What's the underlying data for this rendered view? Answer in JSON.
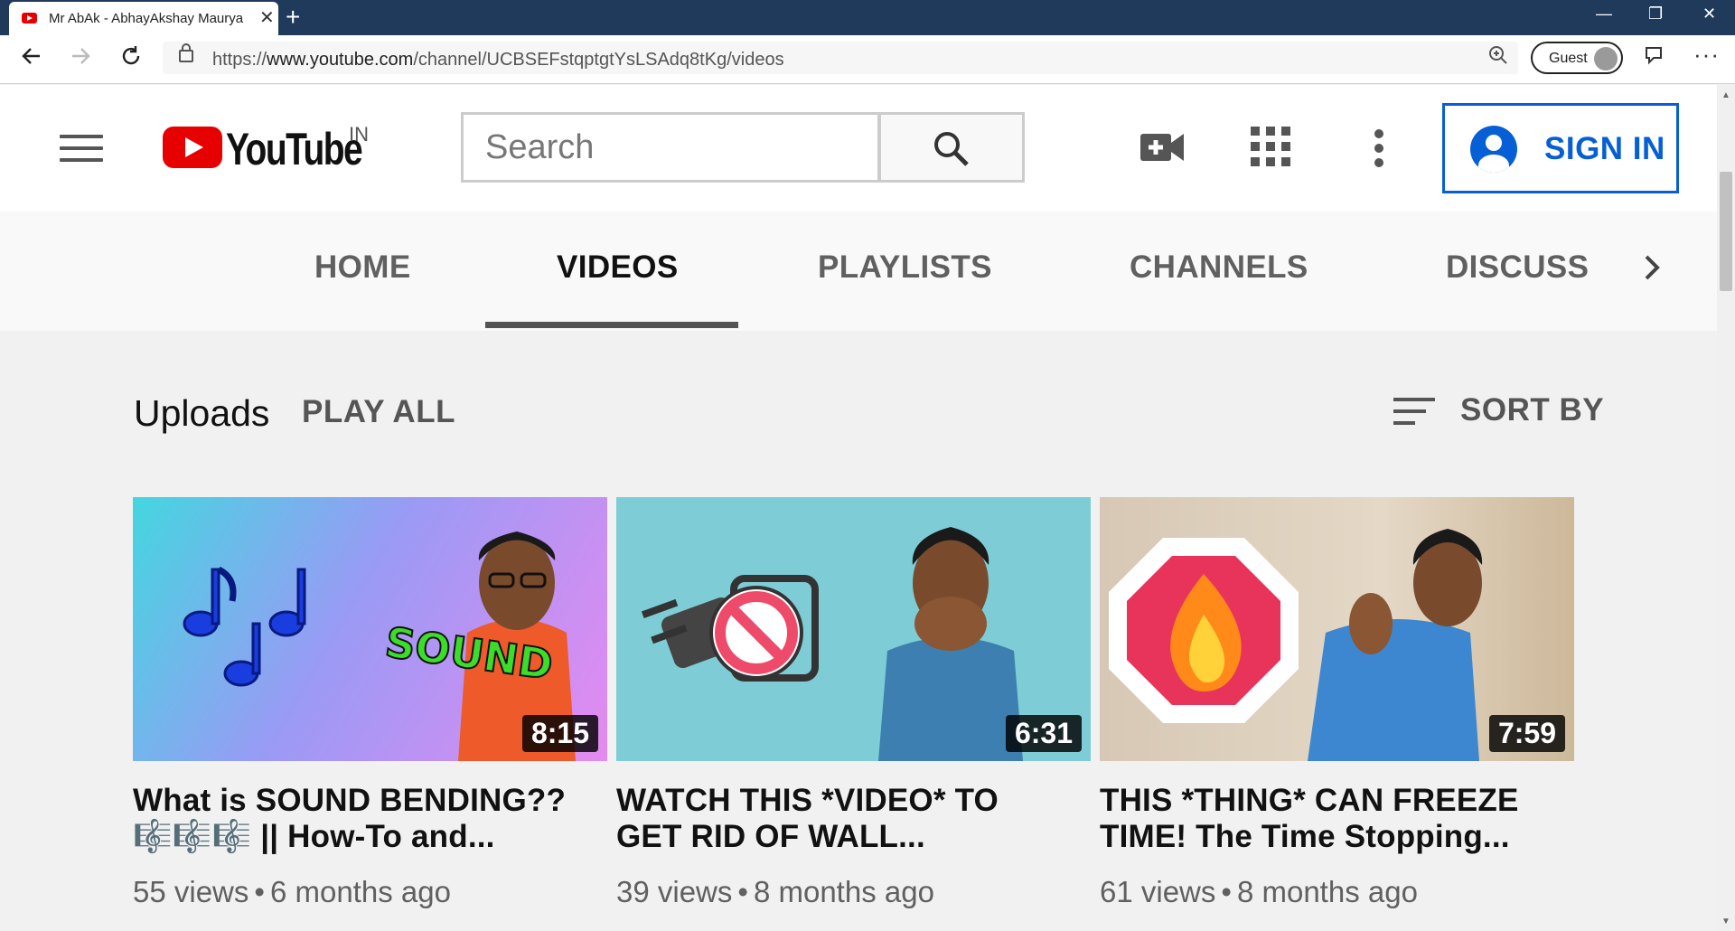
{
  "browser": {
    "tab_title": "Mr AbAk - AbhayAkshay Maurya",
    "tab_close": "✕",
    "new_tab": "+",
    "window_buttons": {
      "minimize": "—",
      "restore": "❐",
      "close": "✕"
    },
    "url_prefix": "https://",
    "url_host": "www.youtube.com",
    "url_path": "/channel/UCBSEFstqptgtYsLSAdq8tKg/videos",
    "guest_label": "Guest"
  },
  "masthead": {
    "logo_text": "YouTube",
    "country_code": "IN",
    "search_placeholder": "Search",
    "sign_in_label": "SIGN IN"
  },
  "channel_tabs": [
    {
      "label": "HOME",
      "active": false
    },
    {
      "label": "VIDEOS",
      "active": true
    },
    {
      "label": "PLAYLISTS",
      "active": false
    },
    {
      "label": "CHANNELS",
      "active": false
    },
    {
      "label": "DISCUSSI",
      "active": false
    }
  ],
  "uploads": {
    "title": "Uploads",
    "play_all": "PLAY ALL",
    "sort_by": "SORT BY"
  },
  "videos": [
    {
      "title_line1": "What is SOUND BENDING??",
      "title_line2": "🎼🎼🎼 || How-To and...",
      "duration": "8:15",
      "views": "55 views",
      "age": "6 months ago",
      "thumb_badge_text": "SOUND"
    },
    {
      "title_line1": "WATCH THIS *VIDEO* TO",
      "title_line2": "GET RID OF WALL...",
      "duration": "6:31",
      "views": "39 views",
      "age": "8 months ago"
    },
    {
      "title_line1": "THIS *THING* CAN FREEZE",
      "title_line2": "TIME! The Time Stopping...",
      "duration": "7:59",
      "views": "61 views",
      "age": "8 months ago"
    }
  ],
  "colors": {
    "titlebar": "#1f3a5a",
    "brand_red": "#e60000",
    "sign_in_blue": "#065fd4",
    "tab_underline": "#555555"
  },
  "icons": [
    "back-icon",
    "forward-icon",
    "refresh-icon",
    "lock-icon",
    "zoom-icon",
    "feedback-icon",
    "more-icon",
    "menu-icon",
    "search-icon",
    "create-video-icon",
    "apps-grid-icon",
    "settings-dots-icon",
    "account-icon",
    "chevron-right-icon",
    "sort-icon"
  ]
}
